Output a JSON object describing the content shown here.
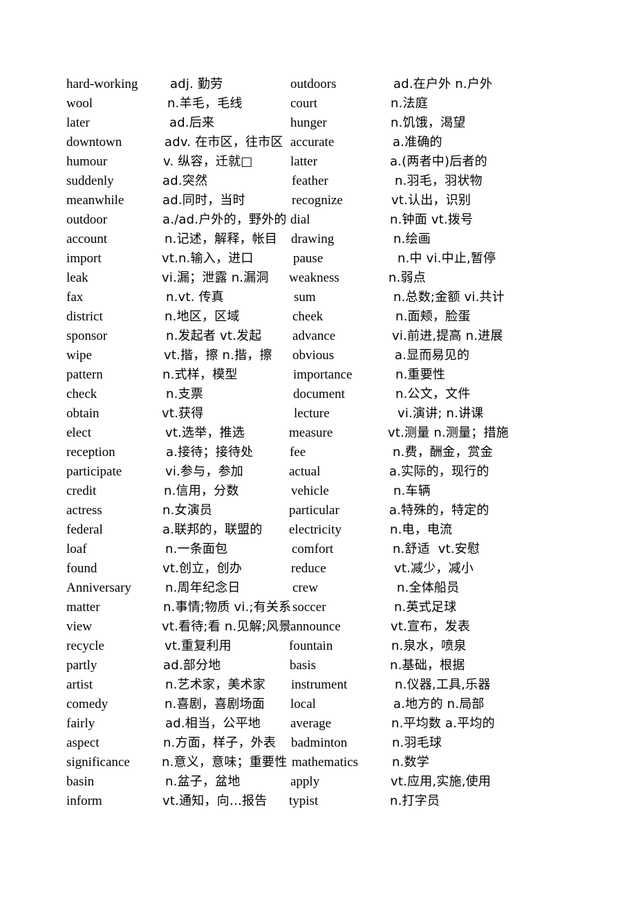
{
  "document": {
    "type": "vocabulary-list",
    "layout": "two-column",
    "columns": 2,
    "rows_per_column": 38
  },
  "left_column": [
    {
      "term": "hard-working",
      "definition": "adj. 勤劳",
      "term_indent": 0,
      "def_indent": 14
    },
    {
      "term": "wool",
      "definition": "n.羊毛，毛线",
      "term_indent": 0,
      "def_indent": 10
    },
    {
      "term": "later",
      "definition": "ad.后来",
      "term_indent": 0,
      "def_indent": 13
    },
    {
      "term": "downtown",
      "definition": "adv. 在市区，往市区",
      "term_indent": 0,
      "def_indent": 6
    },
    {
      "term": "humour",
      "definition": "v. 纵容，迁就□",
      "term_indent": 0,
      "def_indent": 4
    },
    {
      "term": "suddenly",
      "definition": "ad.突然",
      "term_indent": 0,
      "def_indent": 3
    },
    {
      "term": "meanwhile",
      "definition": "ad.同时，当时",
      "term_indent": 0,
      "def_indent": 3
    },
    {
      "term": "outdoor",
      "definition": "a./ad.户外的，野外的",
      "term_indent": 0,
      "def_indent": 3
    },
    {
      "term": "account",
      "definition": "n.记述，解释，帐目",
      "term_indent": 0,
      "def_indent": 6
    },
    {
      "term": "import",
      "definition": "vt.n.输入，进口",
      "term_indent": 0,
      "def_indent": 2
    },
    {
      "term": "leak",
      "definition": "vi.漏；泄露 n.漏洞",
      "term_indent": 0,
      "def_indent": 2
    },
    {
      "term": "fax",
      "definition": "n.vt. 传真",
      "term_indent": 0,
      "def_indent": 8
    },
    {
      "term": "district",
      "definition": "n.地区，区域",
      "term_indent": 0,
      "def_indent": 6
    },
    {
      "term": "sponsor",
      "definition": "n.发起者 vt.发起",
      "term_indent": 0,
      "def_indent": 8
    },
    {
      "term": "wipe",
      "definition": "vt.揩，擦 n.揩，擦",
      "term_indent": 0,
      "def_indent": 5
    },
    {
      "term": "pattern",
      "definition": "n.式样，模型",
      "term_indent": 0,
      "def_indent": 3
    },
    {
      "term": "check",
      "definition": "n.支票",
      "term_indent": 0,
      "def_indent": 8
    },
    {
      "term": "obtain",
      "definition": "vt.获得",
      "term_indent": 0,
      "def_indent": 2
    },
    {
      "term": "elect",
      "definition": "vt.选举，推选",
      "term_indent": 0,
      "def_indent": 7
    },
    {
      "term": "reception",
      "definition": "a.接待；接待处",
      "term_indent": 0,
      "def_indent": 8
    },
    {
      "term": "participate",
      "definition": "vi.参与，参加",
      "term_indent": 0,
      "def_indent": 7
    },
    {
      "term": "credit",
      "definition": "n.信用，分数",
      "term_indent": 0,
      "def_indent": 5
    },
    {
      "term": "actress",
      "definition": "n.女演员",
      "term_indent": 0,
      "def_indent": 3
    },
    {
      "term": "federal",
      "definition": "a.联邦的，联盟的",
      "term_indent": 0,
      "def_indent": 3
    },
    {
      "term": "loaf",
      "definition": "n.一条面包",
      "term_indent": 0,
      "def_indent": 7
    },
    {
      "term": "found",
      "definition": "vt.创立，创办",
      "term_indent": 0,
      "def_indent": 3
    },
    {
      "term": "Anniversary",
      "definition": "n.周年纪念日",
      "term_indent": 0,
      "def_indent": 7
    },
    {
      "term": "matter",
      "definition": "n.事情;物质 vi.;有关系",
      "term_indent": 0,
      "def_indent": 4
    },
    {
      "term": "view",
      "definition": "vt.看待;看 n.见解;风景",
      "term_indent": 0,
      "def_indent": 2
    },
    {
      "term": "recycle",
      "definition": "vt.重复利用",
      "term_indent": 0,
      "def_indent": 6
    },
    {
      "term": "partly",
      "definition": "ad.部分地",
      "term_indent": 0,
      "def_indent": 4
    },
    {
      "term": "artist",
      "definition": "n.艺术家，美术家",
      "term_indent": 0,
      "def_indent": 7
    },
    {
      "term": "comedy",
      "definition": "n.喜剧，喜剧场面",
      "term_indent": 0,
      "def_indent": 6
    },
    {
      "term": "fairly",
      "definition": "ad.相当，公平地",
      "term_indent": 0,
      "def_indent": 7
    },
    {
      "term": "aspect",
      "definition": "n.方面，样子，外表",
      "term_indent": 0,
      "def_indent": 4
    },
    {
      "term": "significance",
      "definition": "n.意义，意味；重要性",
      "term_indent": 0,
      "def_indent": 2
    },
    {
      "term": "basin",
      "definition": "n.盆子，盆地",
      "term_indent": 0,
      "def_indent": 7
    },
    {
      "term": "inform",
      "definition": "vt.通知，向…报告",
      "term_indent": 0,
      "def_indent": 3
    }
  ],
  "right_column": [
    {
      "term": "outdoors",
      "definition": "ad.在户外 n.户外",
      "term_indent": 2,
      "def_indent": 6
    },
    {
      "term": "court",
      "definition": "n.法庭",
      "term_indent": 2,
      "def_indent": 2
    },
    {
      "term": "hunger",
      "definition": "n.饥饿，渴望",
      "term_indent": 2,
      "def_indent": 2
    },
    {
      "term": "accurate",
      "definition": "a.准确的",
      "term_indent": 2,
      "def_indent": 5
    },
    {
      "term": "latter",
      "definition": "a.(两者中)后者的",
      "term_indent": 2,
      "def_indent": 1
    },
    {
      "term": "feather",
      "definition": "n.羽毛，羽状物",
      "term_indent": 4,
      "def_indent": 6
    },
    {
      "term": "recognize",
      "definition": "vt.认出，识别",
      "term_indent": 4,
      "def_indent": 1
    },
    {
      "term": "dial",
      "definition": "n.钟面 vt.拨号",
      "term_indent": 2,
      "def_indent": 1
    },
    {
      "term": "drawing",
      "definition": "n.绘画",
      "term_indent": 3,
      "def_indent": 5
    },
    {
      "term": "pause",
      "definition": "n.中 vi.中止,暂停",
      "term_indent": 6,
      "def_indent": 8
    },
    {
      "term": "weakness",
      "definition": "n.弱点",
      "term_indent": 0,
      "def_indent": 1
    },
    {
      "term": "sum",
      "definition": "n.总数;金额 vi.共计",
      "term_indent": 7,
      "def_indent": 1
    },
    {
      "term": "cheek",
      "definition": "n.面颊，脸蛋",
      "term_indent": 5,
      "def_indent": 6
    },
    {
      "term": "advance",
      "definition": "vi.前进,提高 n.进展",
      "term_indent": 5,
      "def_indent": 1
    },
    {
      "term": "obvious",
      "definition": "a.显而易见的",
      "term_indent": 5,
      "def_indent": 5
    },
    {
      "term": "importance",
      "definition": "n.重要性",
      "term_indent": 6,
      "def_indent": 5
    },
    {
      "term": "document",
      "definition": "n.公文，文件",
      "term_indent": 6,
      "def_indent": 5
    },
    {
      "term": "lecture",
      "definition": "vi.演讲; n.讲课",
      "term_indent": 7,
      "def_indent": 7
    },
    {
      "term": "measure",
      "definition": "vt.测量 n.测量；措施",
      "term_indent": 0,
      "def_indent": 0
    },
    {
      "term": "fee",
      "definition": "n.费，酬金，赏金",
      "term_indent": 1,
      "def_indent": 6
    },
    {
      "term": "actual",
      "definition": "a.实际的，现行的",
      "term_indent": 0,
      "def_indent": 2
    },
    {
      "term": "vehicle",
      "definition": "n.车辆",
      "term_indent": 3,
      "def_indent": 5
    },
    {
      "term": "particular",
      "definition": "a.特殊的，特定的",
      "term_indent": 0,
      "def_indent": 2
    },
    {
      "term": "electricity",
      "definition": "n.电，电流",
      "term_indent": 0,
      "def_indent": 3
    },
    {
      "term": "comfort",
      "definition": "n.舒适  vt.安慰",
      "term_indent": 4,
      "def_indent": 3
    },
    {
      "term": "reduce",
      "definition": "vt.减少，减小",
      "term_indent": 3,
      "def_indent": 6
    },
    {
      "term": "crew",
      "definition": "n.全体船员",
      "term_indent": 5,
      "def_indent": 8
    },
    {
      "term": "soccer",
      "definition": "n.英式足球",
      "term_indent": 5,
      "def_indent": 4
    },
    {
      "term": "announce",
      "definition": "vt.宣布，发表",
      "term_indent": 2,
      "def_indent": 2
    },
    {
      "term": "fountain",
      "definition": "n.泉水，喷泉",
      "term_indent": 0,
      "def_indent": 5
    },
    {
      "term": "basis",
      "definition": "n.基础，根据",
      "term_indent": 1,
      "def_indent": 2
    },
    {
      "term": "instrument",
      "definition": "n.仪器,工具,乐器",
      "term_indent": 3,
      "def_indent": 7
    },
    {
      "term": "local",
      "definition": "a.地方的 n.局部",
      "term_indent": 2,
      "def_indent": 6
    },
    {
      "term": "average",
      "definition": "n.平均数 a.平均的",
      "term_indent": 2,
      "def_indent": 3
    },
    {
      "term": "badminton",
      "definition": "n.羽毛球",
      "term_indent": 3,
      "def_indent": 3
    },
    {
      "term": "mathematics",
      "definition": "n.数学",
      "term_indent": 4,
      "def_indent": 2
    },
    {
      "term": "apply",
      "definition": "vt.应用,实施,使用",
      "term_indent": 2,
      "def_indent": 2
    },
    {
      "term": "typist",
      "definition": "n.打字员",
      "term_indent": 0,
      "def_indent": 3
    }
  ]
}
